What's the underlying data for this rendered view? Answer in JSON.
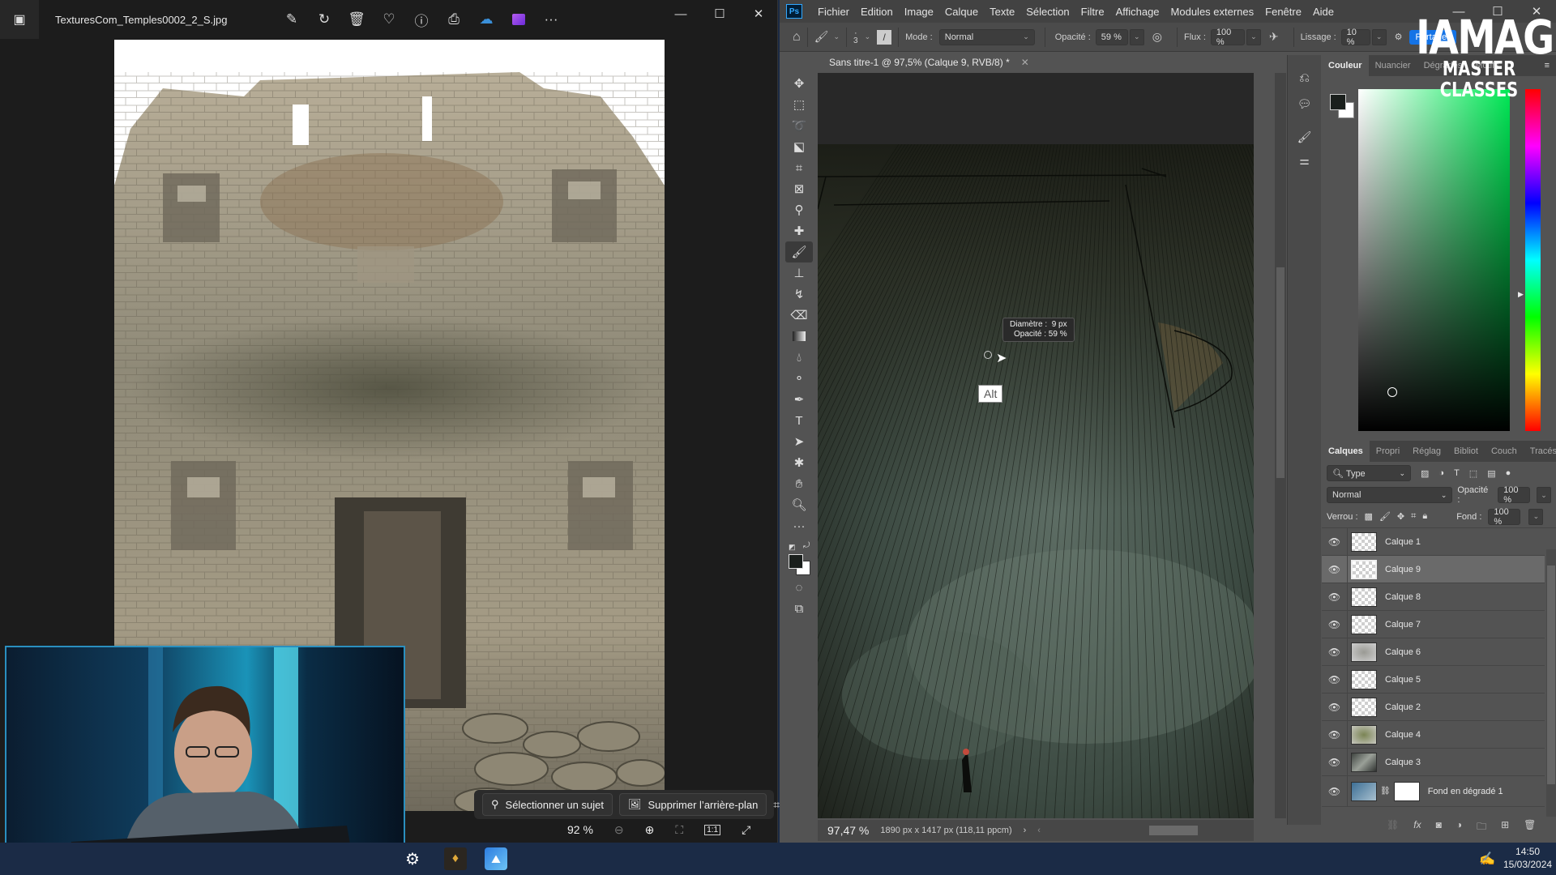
{
  "photos": {
    "filename": "TexturesCom_Temples0002_2_S.jpg",
    "toolbar_icons": [
      "edit-image-icon",
      "rotate-icon",
      "delete-icon",
      "favorite-icon",
      "info-icon",
      "print-icon",
      "onedrive-icon",
      "clipchamp-icon",
      "more-icon"
    ],
    "select_subject_label": "Sélectionner un sujet",
    "remove_background_label": "Supprimer l’arrière-plan",
    "zoom_level": "92 %"
  },
  "photoshop": {
    "app_icon": "Ps",
    "menu": [
      "Fichier",
      "Edition",
      "Image",
      "Calque",
      "Texte",
      "Sélection",
      "Filtre",
      "Affichage",
      "Modules externes",
      "Fenêtre",
      "Aide"
    ],
    "options": {
      "brush_size": "3",
      "mode_label": "Mode :",
      "mode_value": "Normal",
      "opacity_label": "Opacité :",
      "opacity_value": "59 %",
      "flow_label": "Flux :",
      "flow_value": "100 %",
      "smoothing_label": "Lissage :",
      "smoothing_value": "10 %",
      "share_label": "Partager"
    },
    "doc_tab": "Sans titre-1 @ 97,5% (Calque 9, RVB/8) *",
    "brush_tooltip": {
      "diameter_label": "Diamètre :",
      "diameter_value": "9 px",
      "opacity_label": "Opacité :",
      "opacity_value": "59 %"
    },
    "key_hint": "Alt",
    "status": {
      "zoom": "97,47 %",
      "doc_info": "1890 px x 1417 px (118,11 ppcm)"
    },
    "color_panel": {
      "tabs": [
        "Couleur",
        "Nuancier",
        "Dégradés",
        "Motifs"
      ],
      "active_tab": "Couleur",
      "foreground": "#1a1f1c",
      "background": "#ffffff",
      "hue_color": "#00e855"
    },
    "layers_panel": {
      "tabs": [
        "Calques",
        "Propri",
        "Réglag",
        "Bibliot",
        "Couch",
        "Tracés"
      ],
      "active_tab": "Calques",
      "filter_value": "Type",
      "blend_mode": "Normal",
      "opacity_label": "Opacité :",
      "opacity_value": "100 %",
      "lock_label": "Verrou :",
      "fill_label": "Fond :",
      "fill_value": "100 %",
      "layers": [
        {
          "name": "Calque 1",
          "visible": true,
          "selected": false
        },
        {
          "name": "Calque 9",
          "visible": true,
          "selected": true
        },
        {
          "name": "Calque 8",
          "visible": true,
          "selected": false
        },
        {
          "name": "Calque 7",
          "visible": true,
          "selected": false
        },
        {
          "name": "Calque 6",
          "visible": true,
          "selected": false
        },
        {
          "name": "Calque 5",
          "visible": true,
          "selected": false
        },
        {
          "name": "Calque 2",
          "visible": true,
          "selected": false
        },
        {
          "name": "Calque 4",
          "visible": true,
          "selected": false
        },
        {
          "name": "Calque 3",
          "visible": true,
          "selected": false
        },
        {
          "name": "Fond en dégradé 1",
          "visible": true,
          "selected": false
        }
      ]
    }
  },
  "watermark": {
    "line1": "IAMAG",
    "line2": "MASTER CLASSES"
  },
  "taskbar": {
    "time": "14:50",
    "date": "15/03/2024"
  }
}
